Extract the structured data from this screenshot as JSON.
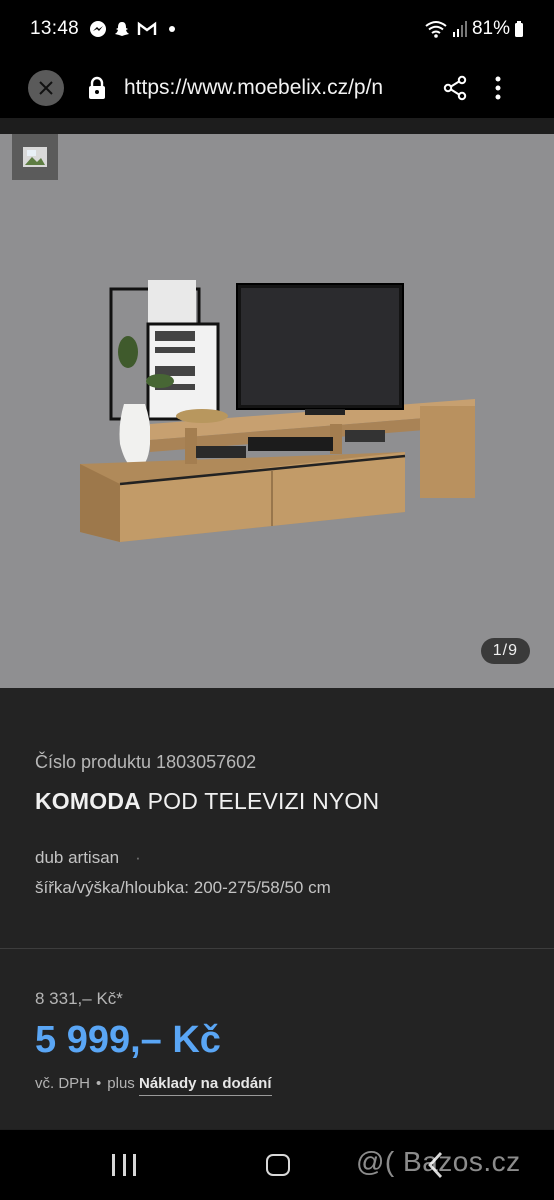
{
  "status_bar": {
    "time": "13:48",
    "battery": "81%"
  },
  "browser": {
    "url": "https://www.moebelix.cz/p/n"
  },
  "gallery": {
    "counter": "1/9"
  },
  "product": {
    "number_label": "Číslo produktu 1803057602",
    "title_bold": "KOMODA",
    "title_rest": " POD TELEVIZI NYON",
    "spec_color": "dub artisan",
    "spec_dims": "šířka/výška/hloubka: 200-275/58/50 cm"
  },
  "price": {
    "old": "8 331,– Kč*",
    "new": "5 999,– Kč",
    "vat": "vč. DPH",
    "plus": "plus",
    "delivery_link": "Náklady na dodání"
  },
  "watermark": "@( Bazos.cz",
  "colors": {
    "price_accent": "#5aa6f5",
    "background": "#232323"
  }
}
